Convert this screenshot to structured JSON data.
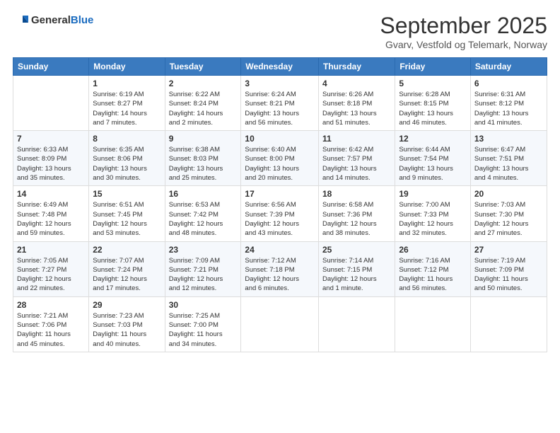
{
  "logo": {
    "general": "General",
    "blue": "Blue"
  },
  "header": {
    "month": "September 2025",
    "location": "Gvarv, Vestfold og Telemark, Norway"
  },
  "days_of_week": [
    "Sunday",
    "Monday",
    "Tuesday",
    "Wednesday",
    "Thursday",
    "Friday",
    "Saturday"
  ],
  "weeks": [
    [
      {
        "day": "",
        "info": ""
      },
      {
        "day": "1",
        "info": "Sunrise: 6:19 AM\nSunset: 8:27 PM\nDaylight: 14 hours\nand 7 minutes."
      },
      {
        "day": "2",
        "info": "Sunrise: 6:22 AM\nSunset: 8:24 PM\nDaylight: 14 hours\nand 2 minutes."
      },
      {
        "day": "3",
        "info": "Sunrise: 6:24 AM\nSunset: 8:21 PM\nDaylight: 13 hours\nand 56 minutes."
      },
      {
        "day": "4",
        "info": "Sunrise: 6:26 AM\nSunset: 8:18 PM\nDaylight: 13 hours\nand 51 minutes."
      },
      {
        "day": "5",
        "info": "Sunrise: 6:28 AM\nSunset: 8:15 PM\nDaylight: 13 hours\nand 46 minutes."
      },
      {
        "day": "6",
        "info": "Sunrise: 6:31 AM\nSunset: 8:12 PM\nDaylight: 13 hours\nand 41 minutes."
      }
    ],
    [
      {
        "day": "7",
        "info": "Sunrise: 6:33 AM\nSunset: 8:09 PM\nDaylight: 13 hours\nand 35 minutes."
      },
      {
        "day": "8",
        "info": "Sunrise: 6:35 AM\nSunset: 8:06 PM\nDaylight: 13 hours\nand 30 minutes."
      },
      {
        "day": "9",
        "info": "Sunrise: 6:38 AM\nSunset: 8:03 PM\nDaylight: 13 hours\nand 25 minutes."
      },
      {
        "day": "10",
        "info": "Sunrise: 6:40 AM\nSunset: 8:00 PM\nDaylight: 13 hours\nand 20 minutes."
      },
      {
        "day": "11",
        "info": "Sunrise: 6:42 AM\nSunset: 7:57 PM\nDaylight: 13 hours\nand 14 minutes."
      },
      {
        "day": "12",
        "info": "Sunrise: 6:44 AM\nSunset: 7:54 PM\nDaylight: 13 hours\nand 9 minutes."
      },
      {
        "day": "13",
        "info": "Sunrise: 6:47 AM\nSunset: 7:51 PM\nDaylight: 13 hours\nand 4 minutes."
      }
    ],
    [
      {
        "day": "14",
        "info": "Sunrise: 6:49 AM\nSunset: 7:48 PM\nDaylight: 12 hours\nand 59 minutes."
      },
      {
        "day": "15",
        "info": "Sunrise: 6:51 AM\nSunset: 7:45 PM\nDaylight: 12 hours\nand 53 minutes."
      },
      {
        "day": "16",
        "info": "Sunrise: 6:53 AM\nSunset: 7:42 PM\nDaylight: 12 hours\nand 48 minutes."
      },
      {
        "day": "17",
        "info": "Sunrise: 6:56 AM\nSunset: 7:39 PM\nDaylight: 12 hours\nand 43 minutes."
      },
      {
        "day": "18",
        "info": "Sunrise: 6:58 AM\nSunset: 7:36 PM\nDaylight: 12 hours\nand 38 minutes."
      },
      {
        "day": "19",
        "info": "Sunrise: 7:00 AM\nSunset: 7:33 PM\nDaylight: 12 hours\nand 32 minutes."
      },
      {
        "day": "20",
        "info": "Sunrise: 7:03 AM\nSunset: 7:30 PM\nDaylight: 12 hours\nand 27 minutes."
      }
    ],
    [
      {
        "day": "21",
        "info": "Sunrise: 7:05 AM\nSunset: 7:27 PM\nDaylight: 12 hours\nand 22 minutes."
      },
      {
        "day": "22",
        "info": "Sunrise: 7:07 AM\nSunset: 7:24 PM\nDaylight: 12 hours\nand 17 minutes."
      },
      {
        "day": "23",
        "info": "Sunrise: 7:09 AM\nSunset: 7:21 PM\nDaylight: 12 hours\nand 12 minutes."
      },
      {
        "day": "24",
        "info": "Sunrise: 7:12 AM\nSunset: 7:18 PM\nDaylight: 12 hours\nand 6 minutes."
      },
      {
        "day": "25",
        "info": "Sunrise: 7:14 AM\nSunset: 7:15 PM\nDaylight: 12 hours\nand 1 minute."
      },
      {
        "day": "26",
        "info": "Sunrise: 7:16 AM\nSunset: 7:12 PM\nDaylight: 11 hours\nand 56 minutes."
      },
      {
        "day": "27",
        "info": "Sunrise: 7:19 AM\nSunset: 7:09 PM\nDaylight: 11 hours\nand 50 minutes."
      }
    ],
    [
      {
        "day": "28",
        "info": "Sunrise: 7:21 AM\nSunset: 7:06 PM\nDaylight: 11 hours\nand 45 minutes."
      },
      {
        "day": "29",
        "info": "Sunrise: 7:23 AM\nSunset: 7:03 PM\nDaylight: 11 hours\nand 40 minutes."
      },
      {
        "day": "30",
        "info": "Sunrise: 7:25 AM\nSunset: 7:00 PM\nDaylight: 11 hours\nand 34 minutes."
      },
      {
        "day": "",
        "info": ""
      },
      {
        "day": "",
        "info": ""
      },
      {
        "day": "",
        "info": ""
      },
      {
        "day": "",
        "info": ""
      }
    ]
  ]
}
